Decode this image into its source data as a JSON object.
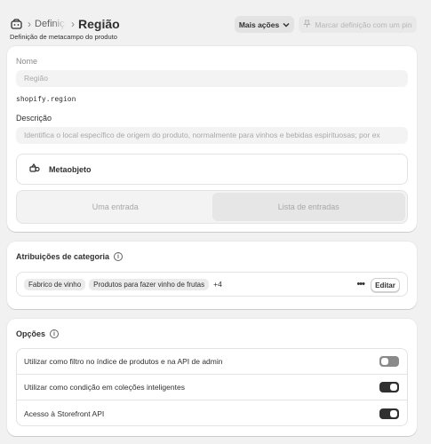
{
  "header": {
    "breadcrumb_mid": "Definições",
    "title": "Região",
    "subtitle": "Definição de metacampo do produto",
    "more_actions_label": "Mais ações",
    "pin_label": "Marcar definição com um pin"
  },
  "main_card": {
    "name_label": "Nome",
    "name_value": "Região",
    "namespace_key": "shopify.region",
    "description_label": "Descrição",
    "description_value": "Identifica o local específico de origem do produto, normalmente para vinhos e bebidas espirituosas; por ex",
    "type_label": "Metaobjeto",
    "segment_single": "Uma entrada",
    "segment_list": "Lista de entradas"
  },
  "category_card": {
    "title": "Atribuições de categoria",
    "tags": [
      "Fabrico de vinho",
      "Produtos para fazer vinho de frutas"
    ],
    "more_count": "+4",
    "edit_label": "Editar"
  },
  "options_card": {
    "title": "Opções",
    "rows": [
      {
        "label": "Utilizar como filtro no índice de produtos e na API de admin",
        "enabled": false
      },
      {
        "label": "Utilizar como condição em coleções inteligentes",
        "enabled": true
      },
      {
        "label": "Acesso à Storefront API",
        "enabled": true
      }
    ]
  },
  "colors": {
    "background": "#f1f1f1",
    "card": "#ffffff",
    "toggle_on": "#303030",
    "toggle_off": "#8a8a8a",
    "text_muted": "#a8a8a8"
  },
  "icons": {
    "breadcrumb": "metafield-icon",
    "more_actions": "chevron-down-icon",
    "pin": "pin-icon",
    "type": "metaobject-icon",
    "info": "info-icon",
    "overflow": "more-horizontal-icon"
  }
}
